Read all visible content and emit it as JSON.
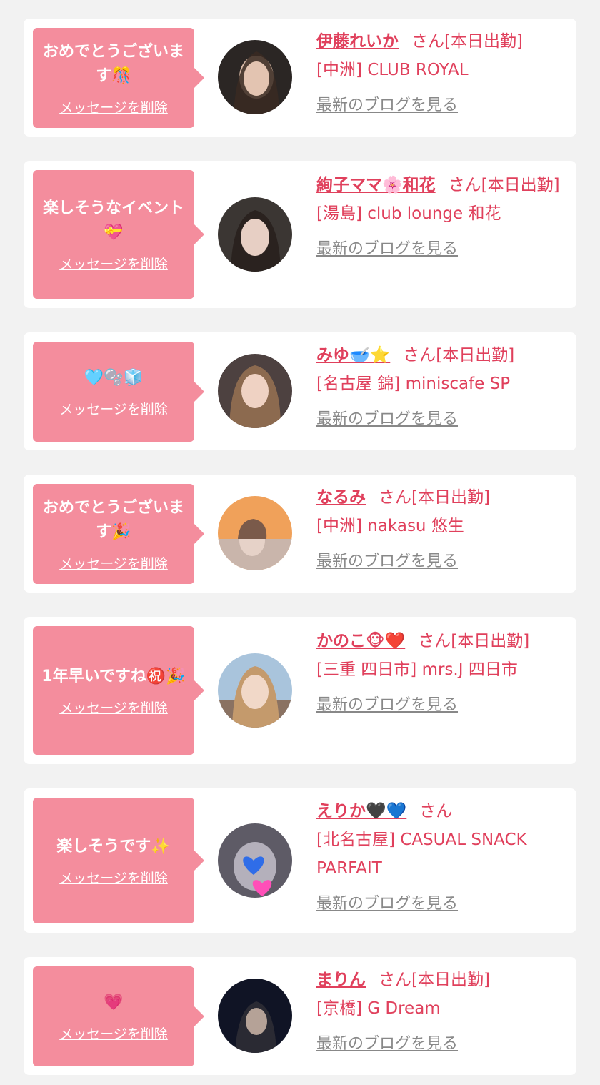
{
  "items": [
    {
      "message": "おめでとうございます🎊",
      "delete_label": "メッセージを削除",
      "name": "伊藤れいか",
      "suffix": "さん[本日出勤]",
      "shop": "[中洲] CLUB ROYAL",
      "blog_label": "最新のブログを見る",
      "avatar_colors": [
        "#2b2624",
        "#d7b9a6",
        "#3a2a22"
      ]
    },
    {
      "message": "楽しそうなイベント💝",
      "delete_label": "メッセージを削除",
      "name": "絢子ママ🌸和花",
      "suffix": "さん[本日出勤]",
      "shop": "[湯島] club lounge 和花",
      "blog_label": "最新のブログを見る",
      "avatar_colors": [
        "#3b3633",
        "#e7cfc4",
        "#2a221f"
      ]
    },
    {
      "message": "🩵🫧🧊",
      "delete_label": "メッセージを削除",
      "name": "みゆ🥣⭐️",
      "suffix": "さん[本日出勤]",
      "shop": "[名古屋 錦] miniscafe SP",
      "blog_label": "最新のブログを見る",
      "avatar_colors": [
        "#4d4140",
        "#efd2c3",
        "#8c6a4f"
      ]
    },
    {
      "message": "おめでとうございます🎉",
      "delete_label": "メッセージを削除",
      "name": "なるみ",
      "suffix": "さん[本日出勤]",
      "shop": "[中洲] nakasu 悠生",
      "blog_label": "最新のブログを見る",
      "avatar_colors": [
        "#f0a15a",
        "#e6d2c8",
        "#7a5a4a"
      ]
    },
    {
      "message": "1年早いですね㊗️🎉",
      "delete_label": "メッセージを削除",
      "name": "かのこ🐵❤️",
      "suffix": "さん[本日出勤]",
      "shop": "[三重 四日市] mrs.J 四日市",
      "blog_label": "最新のブログを見る",
      "avatar_colors": [
        "#a9c4dc",
        "#f1d8c8",
        "#c49a6c"
      ]
    },
    {
      "message": "楽しそうです✨",
      "delete_label": "メッセージを削除",
      "name": "えりか🖤💙",
      "suffix": "さん",
      "shop": "[北名古屋] CASUAL SNACK PARFAIT",
      "blog_label": "最新のブログを見る",
      "avatar_colors": [
        "#5e5b66",
        "#d9d4e0",
        "#2f6de8"
      ]
    },
    {
      "message": "💗",
      "delete_label": "メッセージを削除",
      "name": "まりん",
      "suffix": "さん[本日出勤]",
      "shop": "[京橋] G Dream",
      "blog_label": "最新のブログを見る",
      "avatar_colors": [
        "#101425",
        "#d8c0b0",
        "#2a2a33"
      ]
    }
  ]
}
